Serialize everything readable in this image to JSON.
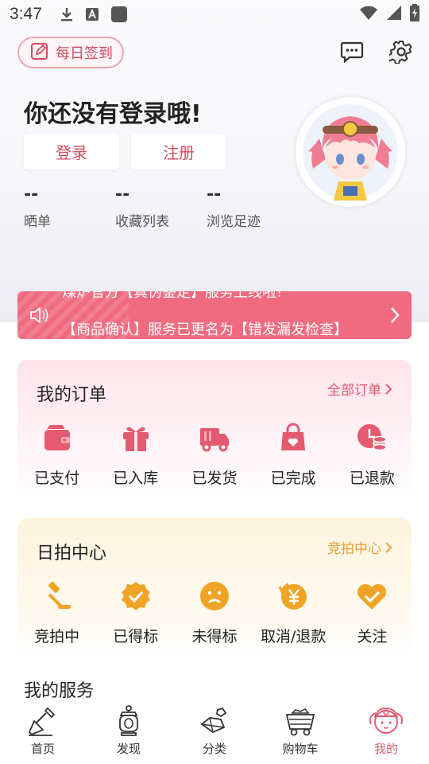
{
  "status_bar": {
    "time": "3:47"
  },
  "header": {
    "checkin_label": "每日签到"
  },
  "profile": {
    "greeting": "你还没有登录哦!",
    "login_label": "登录",
    "register_label": "注册",
    "stats": [
      {
        "value": "--",
        "label": "晒单"
      },
      {
        "value": "--",
        "label": "收藏列表"
      },
      {
        "value": "--",
        "label": "浏览足迹"
      }
    ]
  },
  "notice": {
    "line1": "煤炉官方【真伪鉴定】服务上线啦!",
    "line2": "【商品确认】服务已更名为【错发漏发检查】"
  },
  "orders": {
    "title": "我的订单",
    "more": "全部订单",
    "items": [
      {
        "label": "已支付",
        "icon": "wallet-icon"
      },
      {
        "label": "已入库",
        "icon": "gift-box-icon"
      },
      {
        "label": "已发货",
        "icon": "truck-icon"
      },
      {
        "label": "已完成",
        "icon": "bag-heart-icon"
      },
      {
        "label": "已退款",
        "icon": "refund-coins-icon"
      }
    ]
  },
  "auction": {
    "title": "日拍中心",
    "more": "竞拍中心",
    "items": [
      {
        "label": "竞拍中",
        "icon": "gavel-icon"
      },
      {
        "label": "已得标",
        "icon": "badge-check-icon"
      },
      {
        "label": "未得标",
        "icon": "sad-face-icon"
      },
      {
        "label": "取消/退款",
        "icon": "yen-refund-icon"
      },
      {
        "label": "关注",
        "icon": "heart-check-icon"
      }
    ]
  },
  "services": {
    "title": "我的服务"
  },
  "tabbar": {
    "items": [
      {
        "label": "首页",
        "icon": "shovel-icon"
      },
      {
        "label": "发现",
        "icon": "lantern-icon"
      },
      {
        "label": "分类",
        "icon": "ore-icon"
      },
      {
        "label": "购物车",
        "icon": "minecart-icon"
      },
      {
        "label": "我的",
        "icon": "avatar-icon"
      }
    ],
    "active_index": 4
  },
  "colors": {
    "accent": "#e45a70",
    "notice_bg": "#f06b7f",
    "auction_accent": "#e8a23a",
    "order_icon": "#e45a70",
    "auction_icon": "#f0a426"
  }
}
